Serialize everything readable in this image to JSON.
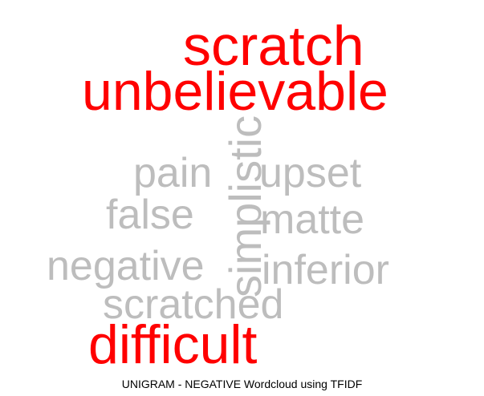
{
  "caption": "UNIGRAM - NEGATIVE Wordcloud using TFIDF",
  "colors": {
    "high_weight": "#ff0000",
    "low_weight": "#bdbdbd",
    "background": "#ffffff"
  },
  "words": [
    {
      "text": "scratch",
      "weight": "high",
      "orientation": "horizontal"
    },
    {
      "text": "unbelievable",
      "weight": "high",
      "orientation": "horizontal"
    },
    {
      "text": "simplistic",
      "weight": "low",
      "orientation": "vertical"
    },
    {
      "text": "pain",
      "weight": "low",
      "orientation": "horizontal"
    },
    {
      "text": "upset",
      "weight": "low",
      "orientation": "horizontal"
    },
    {
      "text": "false",
      "weight": "low",
      "orientation": "horizontal"
    },
    {
      "text": "matte",
      "weight": "low",
      "orientation": "horizontal"
    },
    {
      "text": "negative",
      "weight": "low",
      "orientation": "horizontal"
    },
    {
      "text": "inferior",
      "weight": "low",
      "orientation": "horizontal"
    },
    {
      "text": "scratched",
      "weight": "low",
      "orientation": "horizontal"
    },
    {
      "text": "difficult",
      "weight": "high",
      "orientation": "horizontal"
    }
  ]
}
